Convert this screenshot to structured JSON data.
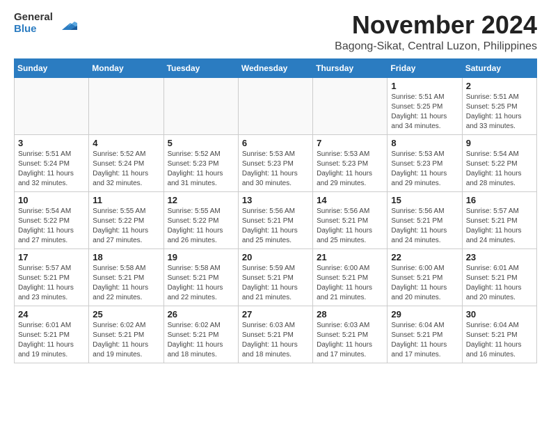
{
  "header": {
    "logo_general": "General",
    "logo_blue": "Blue",
    "month_title": "November 2024",
    "location": "Bagong-Sikat, Central Luzon, Philippines"
  },
  "days_of_week": [
    "Sunday",
    "Monday",
    "Tuesday",
    "Wednesday",
    "Thursday",
    "Friday",
    "Saturday"
  ],
  "weeks": [
    [
      {
        "day": "",
        "info": ""
      },
      {
        "day": "",
        "info": ""
      },
      {
        "day": "",
        "info": ""
      },
      {
        "day": "",
        "info": ""
      },
      {
        "day": "",
        "info": ""
      },
      {
        "day": "1",
        "info": "Sunrise: 5:51 AM\nSunset: 5:25 PM\nDaylight: 11 hours and 34 minutes."
      },
      {
        "day": "2",
        "info": "Sunrise: 5:51 AM\nSunset: 5:25 PM\nDaylight: 11 hours and 33 minutes."
      }
    ],
    [
      {
        "day": "3",
        "info": "Sunrise: 5:51 AM\nSunset: 5:24 PM\nDaylight: 11 hours and 32 minutes."
      },
      {
        "day": "4",
        "info": "Sunrise: 5:52 AM\nSunset: 5:24 PM\nDaylight: 11 hours and 32 minutes."
      },
      {
        "day": "5",
        "info": "Sunrise: 5:52 AM\nSunset: 5:23 PM\nDaylight: 11 hours and 31 minutes."
      },
      {
        "day": "6",
        "info": "Sunrise: 5:53 AM\nSunset: 5:23 PM\nDaylight: 11 hours and 30 minutes."
      },
      {
        "day": "7",
        "info": "Sunrise: 5:53 AM\nSunset: 5:23 PM\nDaylight: 11 hours and 29 minutes."
      },
      {
        "day": "8",
        "info": "Sunrise: 5:53 AM\nSunset: 5:23 PM\nDaylight: 11 hours and 29 minutes."
      },
      {
        "day": "9",
        "info": "Sunrise: 5:54 AM\nSunset: 5:22 PM\nDaylight: 11 hours and 28 minutes."
      }
    ],
    [
      {
        "day": "10",
        "info": "Sunrise: 5:54 AM\nSunset: 5:22 PM\nDaylight: 11 hours and 27 minutes."
      },
      {
        "day": "11",
        "info": "Sunrise: 5:55 AM\nSunset: 5:22 PM\nDaylight: 11 hours and 27 minutes."
      },
      {
        "day": "12",
        "info": "Sunrise: 5:55 AM\nSunset: 5:22 PM\nDaylight: 11 hours and 26 minutes."
      },
      {
        "day": "13",
        "info": "Sunrise: 5:56 AM\nSunset: 5:21 PM\nDaylight: 11 hours and 25 minutes."
      },
      {
        "day": "14",
        "info": "Sunrise: 5:56 AM\nSunset: 5:21 PM\nDaylight: 11 hours and 25 minutes."
      },
      {
        "day": "15",
        "info": "Sunrise: 5:56 AM\nSunset: 5:21 PM\nDaylight: 11 hours and 24 minutes."
      },
      {
        "day": "16",
        "info": "Sunrise: 5:57 AM\nSunset: 5:21 PM\nDaylight: 11 hours and 24 minutes."
      }
    ],
    [
      {
        "day": "17",
        "info": "Sunrise: 5:57 AM\nSunset: 5:21 PM\nDaylight: 11 hours and 23 minutes."
      },
      {
        "day": "18",
        "info": "Sunrise: 5:58 AM\nSunset: 5:21 PM\nDaylight: 11 hours and 22 minutes."
      },
      {
        "day": "19",
        "info": "Sunrise: 5:58 AM\nSunset: 5:21 PM\nDaylight: 11 hours and 22 minutes."
      },
      {
        "day": "20",
        "info": "Sunrise: 5:59 AM\nSunset: 5:21 PM\nDaylight: 11 hours and 21 minutes."
      },
      {
        "day": "21",
        "info": "Sunrise: 6:00 AM\nSunset: 5:21 PM\nDaylight: 11 hours and 21 minutes."
      },
      {
        "day": "22",
        "info": "Sunrise: 6:00 AM\nSunset: 5:21 PM\nDaylight: 11 hours and 20 minutes."
      },
      {
        "day": "23",
        "info": "Sunrise: 6:01 AM\nSunset: 5:21 PM\nDaylight: 11 hours and 20 minutes."
      }
    ],
    [
      {
        "day": "24",
        "info": "Sunrise: 6:01 AM\nSunset: 5:21 PM\nDaylight: 11 hours and 19 minutes."
      },
      {
        "day": "25",
        "info": "Sunrise: 6:02 AM\nSunset: 5:21 PM\nDaylight: 11 hours and 19 minutes."
      },
      {
        "day": "26",
        "info": "Sunrise: 6:02 AM\nSunset: 5:21 PM\nDaylight: 11 hours and 18 minutes."
      },
      {
        "day": "27",
        "info": "Sunrise: 6:03 AM\nSunset: 5:21 PM\nDaylight: 11 hours and 18 minutes."
      },
      {
        "day": "28",
        "info": "Sunrise: 6:03 AM\nSunset: 5:21 PM\nDaylight: 11 hours and 17 minutes."
      },
      {
        "day": "29",
        "info": "Sunrise: 6:04 AM\nSunset: 5:21 PM\nDaylight: 11 hours and 17 minutes."
      },
      {
        "day": "30",
        "info": "Sunrise: 6:04 AM\nSunset: 5:21 PM\nDaylight: 11 hours and 16 minutes."
      }
    ]
  ]
}
